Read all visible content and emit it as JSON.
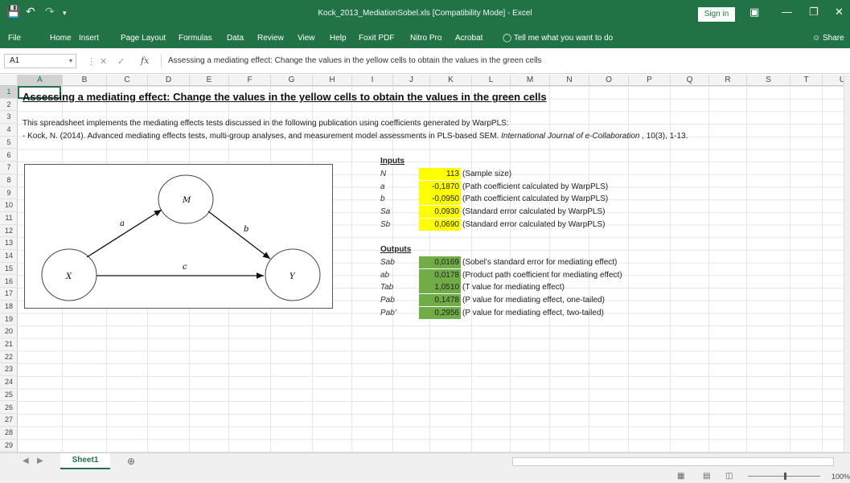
{
  "app": {
    "window_title": "Kock_2013_MediationSobel.xls  [Compatibility Mode]  -  Excel",
    "sign_in": "Sign in",
    "share": "Share"
  },
  "ribbon": {
    "tabs": [
      "File",
      "Home",
      "Insert",
      "Page Layout",
      "Formulas",
      "Data",
      "Review",
      "View",
      "Help",
      "Foxit PDF",
      "Nitro Pro",
      "Acrobat"
    ],
    "tell_me": "Tell me what you want to do"
  },
  "formula_bar": {
    "name_box": "A1",
    "fx": "fx",
    "content": "Assessing a mediating effect: Change the values in the yellow cells to obtain the values in the green cells"
  },
  "columns": [
    "A",
    "B",
    "C",
    "D",
    "E",
    "F",
    "G",
    "H",
    "I",
    "J",
    "K",
    "L",
    "M",
    "N",
    "O",
    "P",
    "Q",
    "R",
    "S",
    "T",
    "U"
  ],
  "rows": [
    "1",
    "2",
    "3",
    "4",
    "5",
    "6",
    "7",
    "8",
    "9",
    "10",
    "11",
    "12",
    "13",
    "14",
    "15",
    "16",
    "17",
    "18",
    "19",
    "20",
    "21",
    "22",
    "23",
    "24",
    "25",
    "26",
    "27",
    "28",
    "29"
  ],
  "sheet": {
    "title": "Assessing a mediating effect: Change the values in the yellow cells to obtain the values in the green cells",
    "line3": "This spreadsheet implements the mediating effects tests discussed in the following publication using coefficients generated by WarpPLS:",
    "line4_pre": " - Kock, N. (2014). Advanced mediating effects tests, multi-group analyses, and measurement model assessments in PLS-based SEM. ",
    "line4_journal": "International Journal of e-Collaboration",
    "line4_post": " , 10(3), 1-13.",
    "inputs_header": "Inputs",
    "outputs_header": "Outputs",
    "inputs": [
      {
        "label": "N",
        "value": "113",
        "desc": "(Sample size)"
      },
      {
        "label": "a",
        "value": "-0,1870",
        "desc": "(Path coefficient calculated by WarpPLS)"
      },
      {
        "label": "b",
        "value": "-0,0950",
        "desc": "(Path coefficient calculated by WarpPLS)"
      },
      {
        "label": "Sa",
        "value": "0,0930",
        "desc": "(Standard error calculated by WarpPLS)"
      },
      {
        "label": "Sb",
        "value": "0,0690",
        "desc": "(Standard error calculated by WarpPLS)"
      }
    ],
    "outputs": [
      {
        "label": "Sab",
        "value": "0,0169",
        "desc": "(Sobel's standard error for mediating effect)"
      },
      {
        "label": "ab",
        "value": "0,0178",
        "desc": "(Product path coefficient for mediating effect)"
      },
      {
        "label": "Tab",
        "value": "1,0510",
        "desc": "(T value for mediating effect)"
      },
      {
        "label": "Pab",
        "value": "0,1478",
        "desc": "(P value for mediating effect, one-tailed)"
      },
      {
        "label": "Pab'",
        "value": "0,2956",
        "desc": "(P value for mediating effect, two-tailed)"
      }
    ],
    "colors": {
      "input_cell": "#ffff00",
      "output_cell": "#70ad47",
      "accent": "#217346"
    }
  },
  "diagram": {
    "nodes": {
      "x": "X",
      "m": "M",
      "y": "Y"
    },
    "paths": {
      "a": "a",
      "b": "b",
      "c": "c"
    }
  },
  "sheet_tabs": {
    "active": "Sheet1"
  },
  "status": {
    "zoom": "100%"
  }
}
